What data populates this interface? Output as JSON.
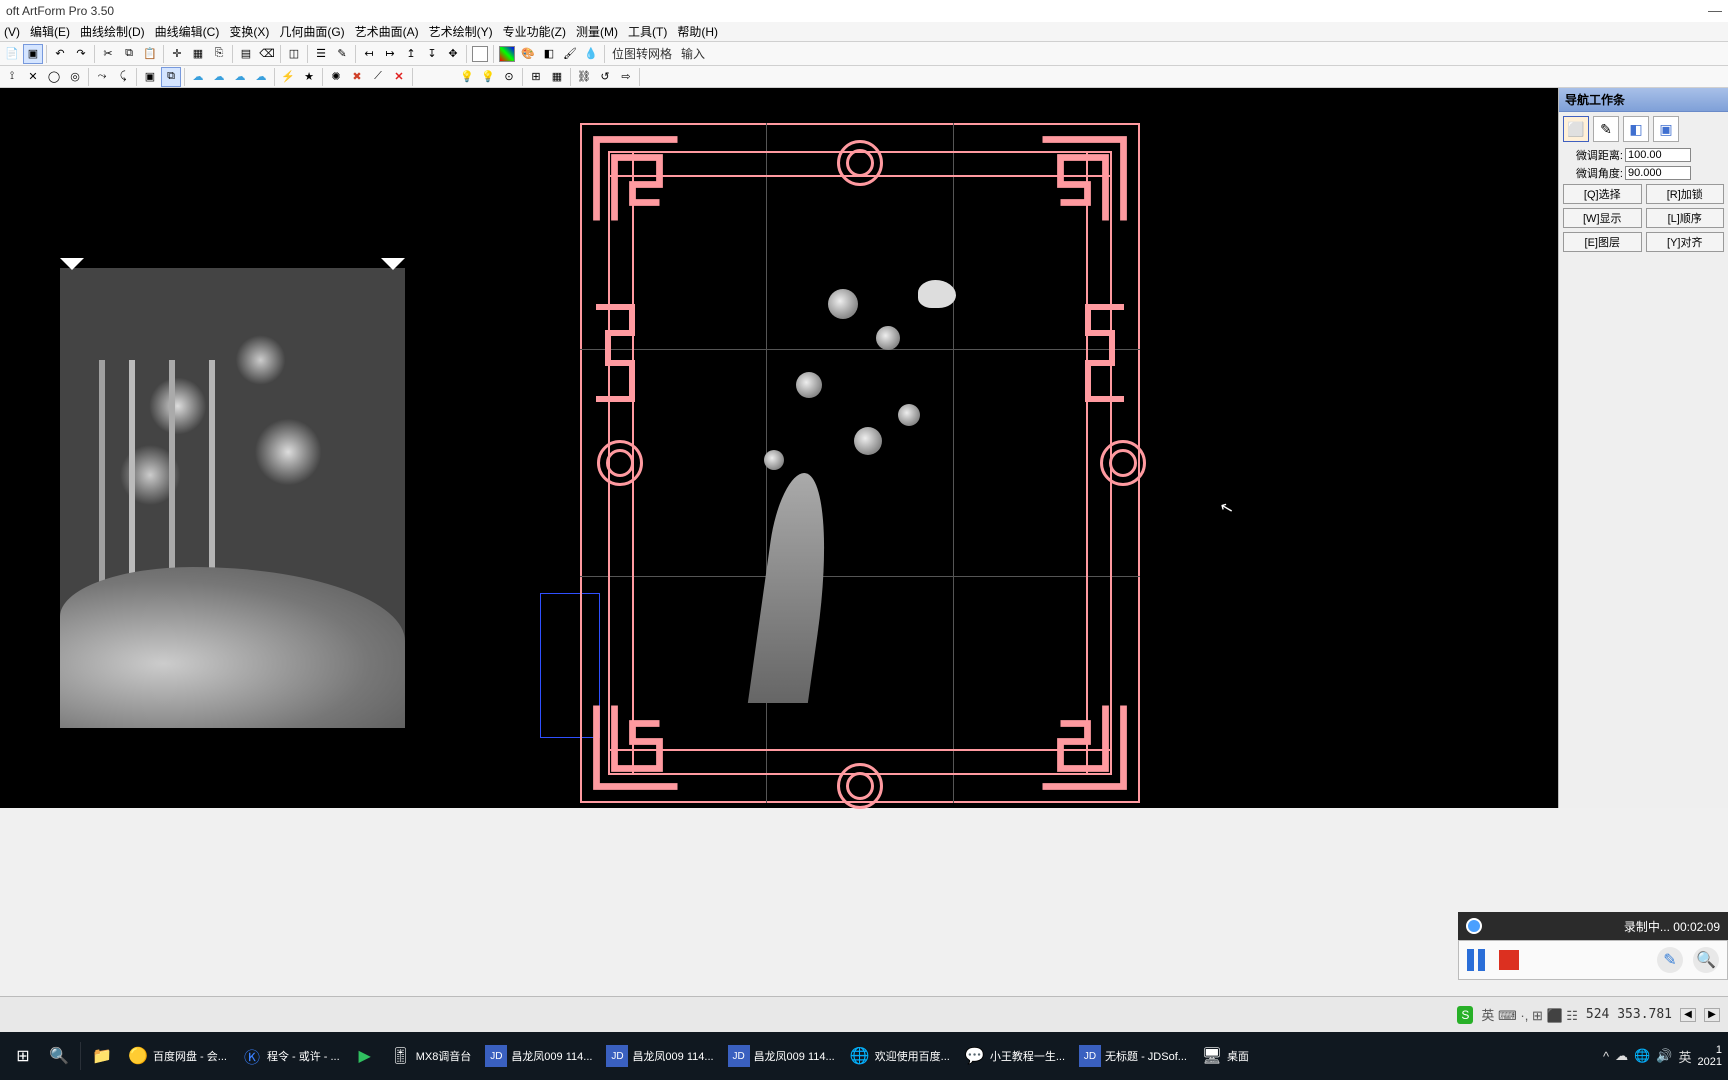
{
  "title": "oft ArtForm Pro 3.50",
  "menus": [
    "(V)",
    "编辑(E)",
    "曲线绘制(D)",
    "曲线编辑(C)",
    "变换(X)",
    "几何曲面(G)",
    "艺术曲面(A)",
    "艺术绘制(Y)",
    "专业功能(Z)",
    "测量(M)",
    "工具(T)",
    "帮助(H)"
  ],
  "toolbar1_text": {
    "bitmap": "位图转网格",
    "input": "输入"
  },
  "sidepanel": {
    "title": "导航工作条",
    "fine_dist_label": "微调距离:",
    "fine_dist_value": "100.00",
    "fine_angle_label": "微调角度:",
    "fine_angle_value": "90.000",
    "btn_select": "[Q]选择",
    "btn_lock": "[R]加锁",
    "btn_show": "[W]显示",
    "btn_order": "[L]顺序",
    "btn_layer": "[E]图层",
    "btn_align": "[Y]对齐"
  },
  "recorder": {
    "status": "录制中...",
    "time": "00:02:09"
  },
  "status": {
    "ime": "英",
    "icons_text": "英 ⌨ ·, ⊞ ⬛ ☷",
    "coords": "524 353.781"
  },
  "taskbar": {
    "items": [
      {
        "icon": "⊞",
        "label": ""
      },
      {
        "icon": "🔍",
        "label": ""
      },
      {
        "icon": "📁",
        "label": ""
      },
      {
        "icon": "🟡",
        "label": "百度网盘 - 会..."
      },
      {
        "icon": "Ⓚ",
        "label": "程令 - 或许 - ..."
      },
      {
        "icon": "▶",
        "label": ""
      },
      {
        "icon": "🎚",
        "label": "MX8调音台"
      },
      {
        "icon": "JD",
        "label": "昌龙凤009 114..."
      },
      {
        "icon": "JD",
        "label": "昌龙凤009 114..."
      },
      {
        "icon": "JD",
        "label": "昌龙凤009 114..."
      },
      {
        "icon": "🌐",
        "label": "欢迎使用百度..."
      },
      {
        "icon": "💬",
        "label": "小王教程一生..."
      },
      {
        "icon": "JD",
        "label": "无标题 - JDSof..."
      },
      {
        "icon": "🖥",
        "label": "桌面"
      }
    ],
    "tray_lang": "英",
    "clock_time": "1",
    "clock_date": "2021"
  }
}
